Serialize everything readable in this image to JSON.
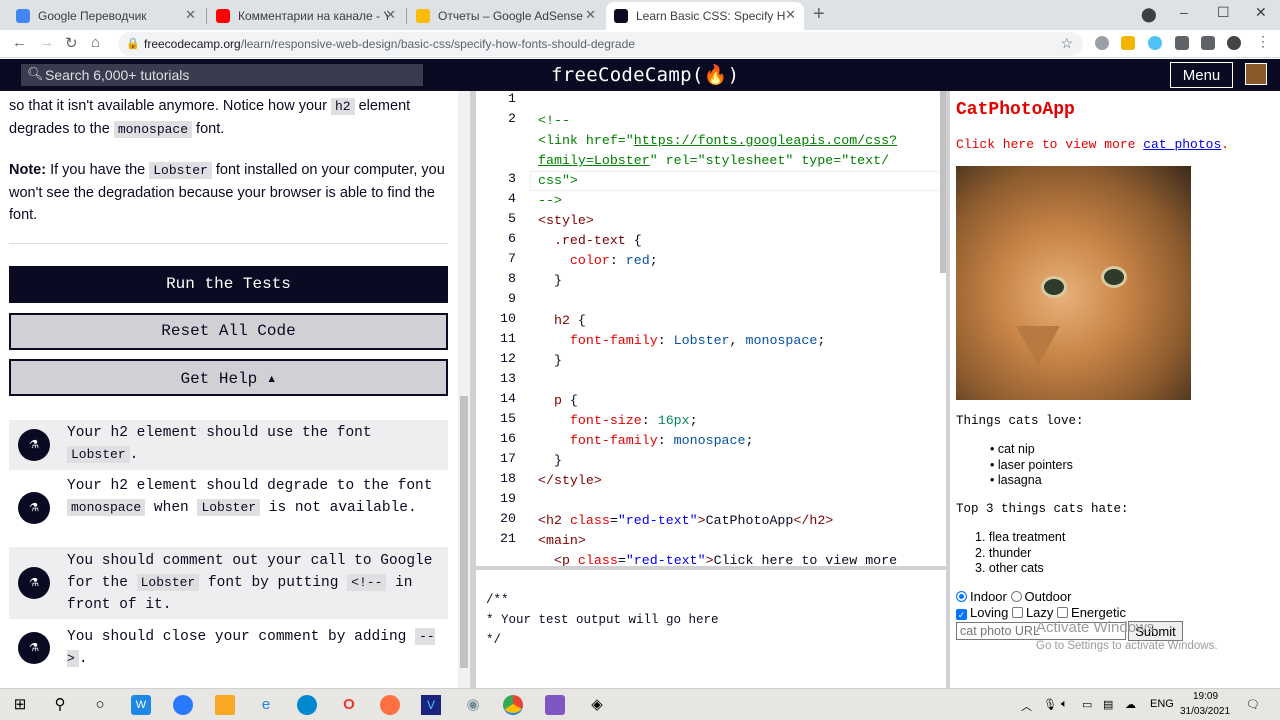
{
  "browser": {
    "tabs": [
      {
        "title": "Google Переводчик",
        "color": "#4285f4"
      },
      {
        "title": "Комментарии на канале - YouTube",
        "color": "#ff0000"
      },
      {
        "title": "Отчеты – Google AdSense",
        "color": "#fbbc04"
      },
      {
        "title": "Learn Basic CSS: Specify How Fonts",
        "color": "#0a0a23"
      }
    ],
    "url_host": "freecodecamp.org",
    "url_path": "/learn/responsive-web-design/basic-css/specify-how-fonts-should-degrade"
  },
  "nav": {
    "search_placeholder": "Search 6,000+ tutorials",
    "logo": "freeCodeCamp(🔥)",
    "menu": "Menu"
  },
  "lesson": {
    "p1_a": "so that it isn't available anymore. Notice how your ",
    "p1_code1": "h2",
    "p1_b": " element degrades to the ",
    "p1_code2": "monospace",
    "p1_c": " font.",
    "p2_bold": "Note:",
    "p2_a": " If you have the ",
    "p2_code": "Lobster",
    "p2_b": " font installed on your computer, you won't see the degradation because your browser is able to find the font."
  },
  "buttons": {
    "run": "Run the Tests",
    "reset": "Reset All Code",
    "help": "Get Help ▴"
  },
  "tests": [
    {
      "a": "Your h2 element should use the font ",
      "c1": "Lobster",
      "b": "."
    },
    {
      "a": "Your h2 element should degrade to the font ",
      "c1": "monospace",
      "b": " when ",
      "c2": "Lobster",
      "c": " is not available."
    },
    {
      "a": "You should comment out your call to Google for the ",
      "c1": "Lobster",
      "b": " font by putting ",
      "c2": "<!--",
      "c": " in front of it."
    },
    {
      "a": "You should close your comment by adding ",
      "c1": "-->",
      "b": "."
    }
  ],
  "editor": {
    "line_numbers": [
      "1",
      "2",
      "",
      "",
      "3",
      "4",
      "5",
      "6",
      "7",
      "8",
      "9",
      "10",
      "11",
      "12",
      "13",
      "14",
      "15",
      "16",
      "17",
      "18",
      "19",
      "20",
      "21"
    ]
  },
  "output": {
    "l1": "/**",
    "l2": "* Your test output will go here",
    "l3": "*/"
  },
  "preview": {
    "title": "CatPhotoApp",
    "click_text": "Click here to view more ",
    "link": "cat photos",
    "click_end": ".",
    "love_heading": "Things cats love:",
    "love": [
      "cat nip",
      "laser pointers",
      "lasagna"
    ],
    "hate_heading": "Top 3 things cats hate:",
    "hate": [
      "flea treatment",
      "thunder",
      "other cats"
    ],
    "radio": [
      "Indoor",
      "Outdoor"
    ],
    "checks": [
      "Loving",
      "Lazy",
      "Energetic"
    ],
    "input_placeholder": "cat photo URL",
    "submit": "Submit"
  },
  "watermark": {
    "line1": "Activate Windows",
    "line2": "Go to Settings to activate Windows."
  },
  "taskbar": {
    "lang": "ENG",
    "time": "19:09",
    "date": "31/03/2021"
  }
}
